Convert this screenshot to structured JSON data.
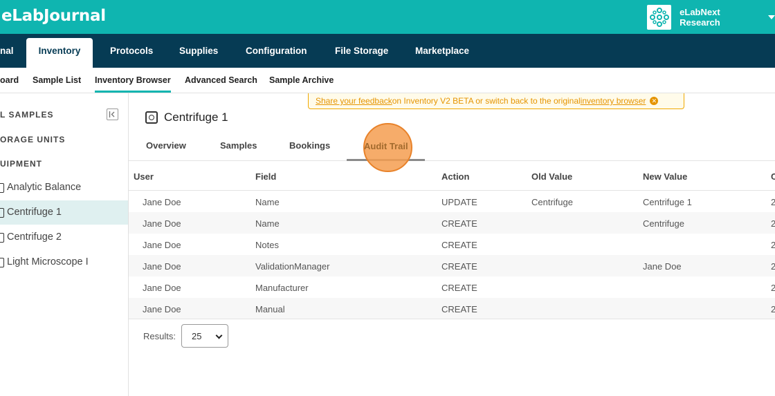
{
  "header": {
    "brand": "eLabJournal",
    "org_name": "eLabNext Research",
    "accent_color": "#0fb5b0",
    "nav_color": "#063b54"
  },
  "main_nav": {
    "items": [
      {
        "label": "nal"
      },
      {
        "label": "Inventory",
        "active": true
      },
      {
        "label": "Protocols"
      },
      {
        "label": "Supplies"
      },
      {
        "label": "Configuration"
      },
      {
        "label": "File Storage"
      },
      {
        "label": "Marketplace"
      }
    ]
  },
  "sub_nav": {
    "items": [
      {
        "label": "oard"
      },
      {
        "label": "Sample List"
      },
      {
        "label": "Inventory Browser",
        "active": true
      },
      {
        "label": "Advanced Search"
      },
      {
        "label": "Sample Archive"
      }
    ]
  },
  "sidebar": {
    "sections": [
      "L SAMPLES",
      "ORAGE UNITS",
      "UIPMENT"
    ],
    "equipment": [
      {
        "label": "Analytic Balance"
      },
      {
        "label": "Centrifuge 1",
        "active": true
      },
      {
        "label": "Centrifuge 2"
      },
      {
        "label": "Light Microscope I"
      }
    ]
  },
  "feedback": {
    "link1": "Share your feedback ",
    "middle": "on Inventory V2 BETA or switch back to the original ",
    "link2": "inventory browser"
  },
  "content": {
    "title": "Centrifuge 1",
    "tabs": [
      {
        "label": "Overview"
      },
      {
        "label": "Samples"
      },
      {
        "label": "Bookings"
      },
      {
        "label": "Audit Trail",
        "active": true
      }
    ]
  },
  "table": {
    "columns": [
      "User",
      "Field",
      "Action",
      "Old Value",
      "New Value",
      "C"
    ],
    "rows": [
      [
        "Jane Doe",
        "Name",
        "UPDATE",
        "Centrifuge",
        "Centrifuge 1",
        "2"
      ],
      [
        "Jane Doe",
        "Name",
        "CREATE",
        "",
        "Centrifuge",
        "2"
      ],
      [
        "Jane Doe",
        "Notes",
        "CREATE",
        "",
        "",
        "2"
      ],
      [
        "Jane Doe",
        "ValidationManager",
        "CREATE",
        "",
        "Jane Doe",
        "2"
      ],
      [
        "Jane Doe",
        "Manufacturer",
        "CREATE",
        "",
        "",
        "2"
      ],
      [
        "Jane Doe",
        "Manual",
        "CREATE",
        "",
        "",
        "2"
      ]
    ]
  },
  "pagination": {
    "results_label": "Results:",
    "results_value": "25"
  }
}
